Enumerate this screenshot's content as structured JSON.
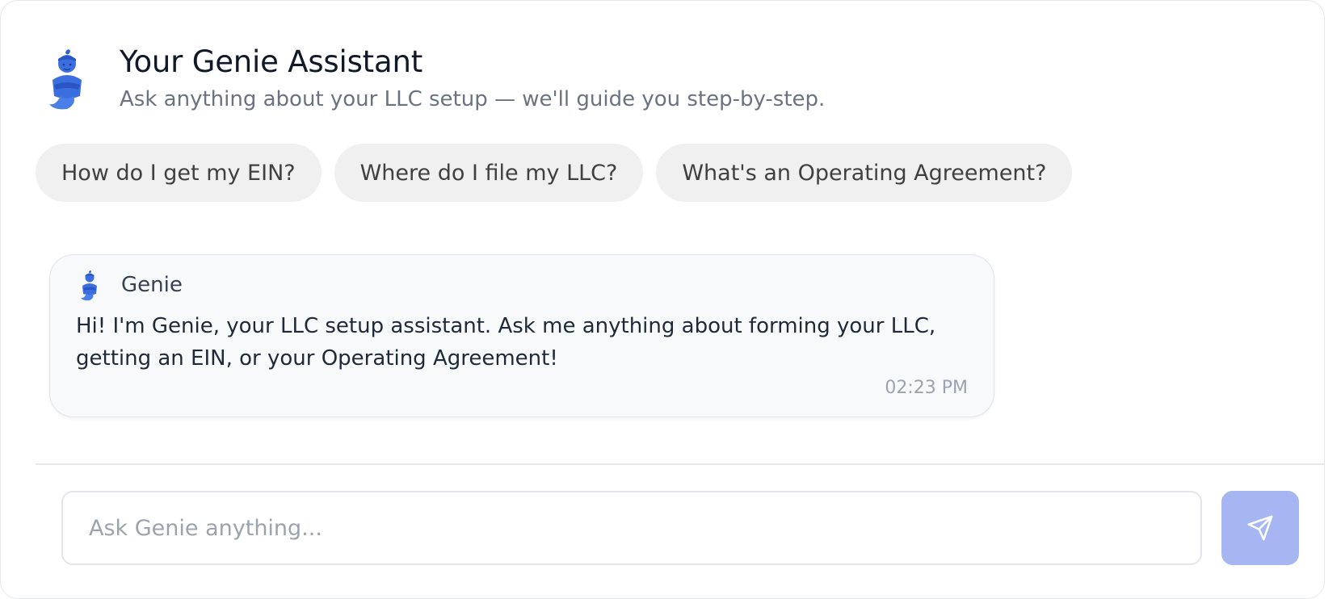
{
  "header": {
    "title": "Your Genie Assistant",
    "subtitle": "Ask anything about your LLC setup — we'll guide you step-by-step.",
    "avatar_icon": "genie-mascot-icon"
  },
  "suggestions": [
    {
      "label": "How do I get my EIN?"
    },
    {
      "label": "Where do I file my LLC?"
    },
    {
      "label": "What's an Operating Agreement?"
    }
  ],
  "messages": [
    {
      "sender": "Genie",
      "avatar_icon": "genie-mascot-icon",
      "text": "Hi! I'm Genie, your LLC setup assistant. Ask me anything about forming your LLC, getting an EIN, or your Operating Agreement!",
      "time": "02:23 PM"
    }
  ],
  "composer": {
    "placeholder": "Ask Genie anything...",
    "value": "",
    "send_icon": "send-icon"
  },
  "colors": {
    "genie_blue": "#3b6fe0",
    "chip_bg": "#f0f0f0",
    "send_button_bg": "#a5b6f3",
    "message_bg": "#f8f9fb"
  }
}
